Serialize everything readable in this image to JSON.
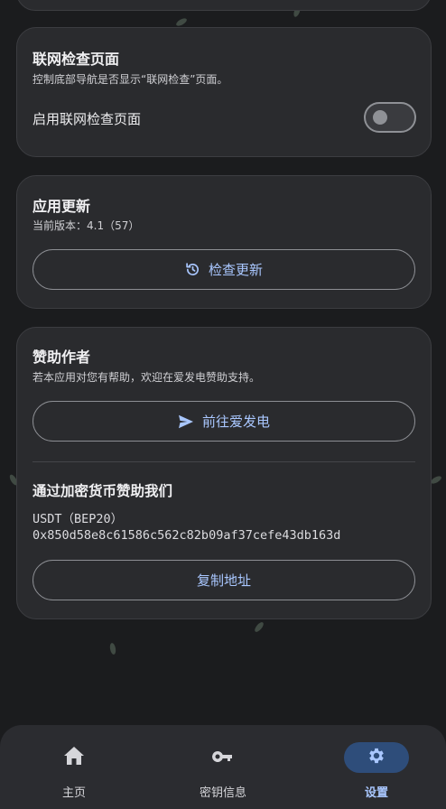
{
  "network_check": {
    "title": "联网检查页面",
    "description": "控制底部导航是否显示“联网检查”页面。",
    "toggle_label": "启用联网检查页面",
    "toggle_on": false
  },
  "app_update": {
    "title": "应用更新",
    "version_text": "当前版本：4.1（57）",
    "button_label": "检查更新",
    "button_icon": "history-icon"
  },
  "sponsor": {
    "title": "赞助作者",
    "description": "若本应用对您有帮助，欢迎在爱发电赞助支持。",
    "button_label": "前往爱发电",
    "button_icon": "send-icon",
    "crypto_title": "通过加密货币赞助我们",
    "crypto_network": "USDT（BEP20）",
    "crypto_address": "0x850d58e8c61586c562c82b09af37cefe43db163d",
    "copy_button_label": "复制地址"
  },
  "bottom_nav": {
    "items": [
      {
        "label": "主页",
        "icon": "home-icon",
        "active": false
      },
      {
        "label": "密钥信息",
        "icon": "key-icon",
        "active": false
      },
      {
        "label": "设置",
        "icon": "gear-icon",
        "active": true
      }
    ]
  },
  "colors": {
    "background": "#1b1c1e",
    "card": "#2a2b2e",
    "accent": "#a9c7ff",
    "active_pill": "#2e4d7a"
  }
}
